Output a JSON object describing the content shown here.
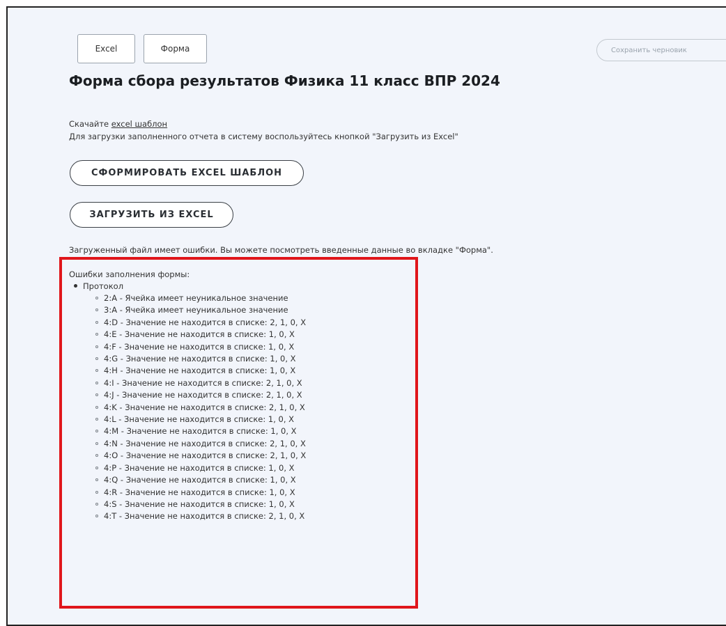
{
  "tabs": [
    {
      "label": "Excel"
    },
    {
      "label": "Форма"
    }
  ],
  "save_draft_label": "Сохранить черновик",
  "title": "Форма сбора результатов Физика 11 класс ВПР 2024",
  "download_prefix": "Скачайте ",
  "download_link": "excel шаблон",
  "upload_hint": "Для загрузки заполненного отчета в систему воспользуйтесь кнопкой \"Загрузить из Excel\"",
  "buttons": {
    "make_template": "СФОРМИРОВАТЬ EXCEL ШАБЛОН",
    "upload_excel": "ЗАГРУЗИТЬ ИЗ EXCEL"
  },
  "status_message": "Загруженный файл имеет ошибки. Вы можете посмотреть введенные данные во вкладке \"Форма\".",
  "errors": {
    "heading": "Ошибки заполнения формы:",
    "group": "Протокол",
    "items": [
      "2:A - Ячейка имеет неуникальное значение",
      "3:A - Ячейка имеет неуникальное значение",
      "4:D - Значение не находится в списке: 2, 1, 0, X",
      "4:E - Значение не находится в списке: 1, 0, X",
      "4:F - Значение не находится в списке: 1, 0, X",
      "4:G - Значение не находится в списке: 1, 0, X",
      "4:H - Значение не находится в списке: 1, 0, X",
      "4:I - Значение не находится в списке: 2, 1, 0, X",
      "4:J - Значение не находится в списке: 2, 1, 0, X",
      "4:K - Значение не находится в списке: 2, 1, 0, X",
      "4:L - Значение не находится в списке: 1, 0, X",
      "4:M - Значение не находится в списке: 1, 0, X",
      "4:N - Значение не находится в списке: 2, 1, 0, X",
      "4:O - Значение не находится в списке: 2, 1, 0, X",
      "4:P - Значение не находится в списке: 1, 0, X",
      "4:Q - Значение не находится в списке: 1, 0, X",
      "4:R - Значение не находится в списке: 1, 0, X",
      "4:S - Значение не находится в списке: 1, 0, X",
      "4:T - Значение не находится в списке: 2, 1, 0, X"
    ]
  },
  "colors": {
    "background": "#f2f5fb",
    "highlight_border": "#e0161b",
    "text": "#333333"
  }
}
